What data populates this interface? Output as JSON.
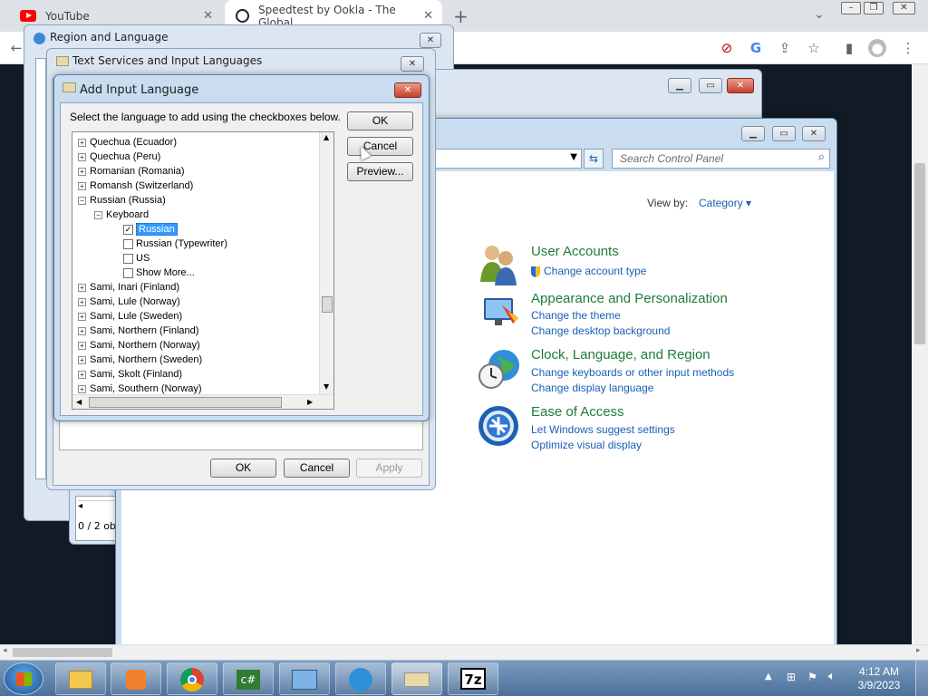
{
  "browser": {
    "tabs": [
      {
        "label": "YouTube"
      },
      {
        "label": "Speedtest by Ookla - The Global"
      }
    ],
    "new_tab": "+",
    "tab_close": "✕"
  },
  "region_window": {
    "title": "Region and Language"
  },
  "text_services": {
    "title": "Text Services and Input Languages",
    "ok": "OK",
    "cancel": "Cancel",
    "apply": "Apply",
    "status": "0 / 2 ob"
  },
  "add_lang": {
    "title": "Add Input Language",
    "instruction": "Select the language to add using the checkboxes below.",
    "ok": "OK",
    "cancel": "Cancel",
    "preview": "Preview...",
    "tree": [
      {
        "label": "Quechua (Ecuador)",
        "type": "node"
      },
      {
        "label": "Quechua (Peru)",
        "type": "node"
      },
      {
        "label": "Romanian (Romania)",
        "type": "node"
      },
      {
        "label": "Romansh (Switzerland)",
        "type": "node"
      },
      {
        "label": "Russian (Russia)",
        "type": "open"
      },
      {
        "label": "Keyboard",
        "type": "sub"
      },
      {
        "label": "Russian",
        "type": "check",
        "checked": true,
        "selected": true
      },
      {
        "label": "Russian (Typewriter)",
        "type": "check",
        "checked": false
      },
      {
        "label": "US",
        "type": "check",
        "checked": false
      },
      {
        "label": "Show More...",
        "type": "check",
        "checked": false
      },
      {
        "label": "Sami, Inari (Finland)",
        "type": "node"
      },
      {
        "label": "Sami, Lule (Norway)",
        "type": "node"
      },
      {
        "label": "Sami, Lule (Sweden)",
        "type": "node"
      },
      {
        "label": "Sami, Northern (Finland)",
        "type": "node"
      },
      {
        "label": "Sami, Northern (Norway)",
        "type": "node"
      },
      {
        "label": "Sami, Northern (Sweden)",
        "type": "node"
      },
      {
        "label": "Sami, Skolt (Finland)",
        "type": "node"
      },
      {
        "label": "Sami, Southern (Norway)",
        "type": "node"
      }
    ]
  },
  "control_panel": {
    "search_placeholder": "Search Control Panel",
    "view_by_label": "View by:",
    "view_by_value": "Category",
    "categories": [
      {
        "title": "User Accounts",
        "links": [
          "Change account type"
        ],
        "icon": "users-icon"
      },
      {
        "title": "Appearance and Personalization",
        "links": [
          "Change the theme",
          "Change desktop background"
        ],
        "icon": "appearance-icon"
      },
      {
        "title": "Clock, Language, and Region",
        "links": [
          "Change keyboards or other input methods",
          "Change display language"
        ],
        "icon": "clock-globe-icon"
      },
      {
        "title": "Ease of Access",
        "links": [
          "Let Windows suggest settings",
          "Optimize visual display"
        ],
        "icon": "ease-of-access-icon"
      }
    ]
  },
  "taskbar": {
    "apps": [
      "explorer",
      "media-player",
      "chrome",
      "csharp",
      "control-panel",
      "clock-globe",
      "keyboard",
      "7-zip"
    ],
    "seven_zip_label": "7z",
    "csharp_label": "c#",
    "time": "4:12 AM",
    "date": "3/9/2023"
  },
  "colors": {
    "taskbar": "#5b7ea8",
    "link": "#1a5fb4",
    "category_title": "#1e7d3a"
  }
}
